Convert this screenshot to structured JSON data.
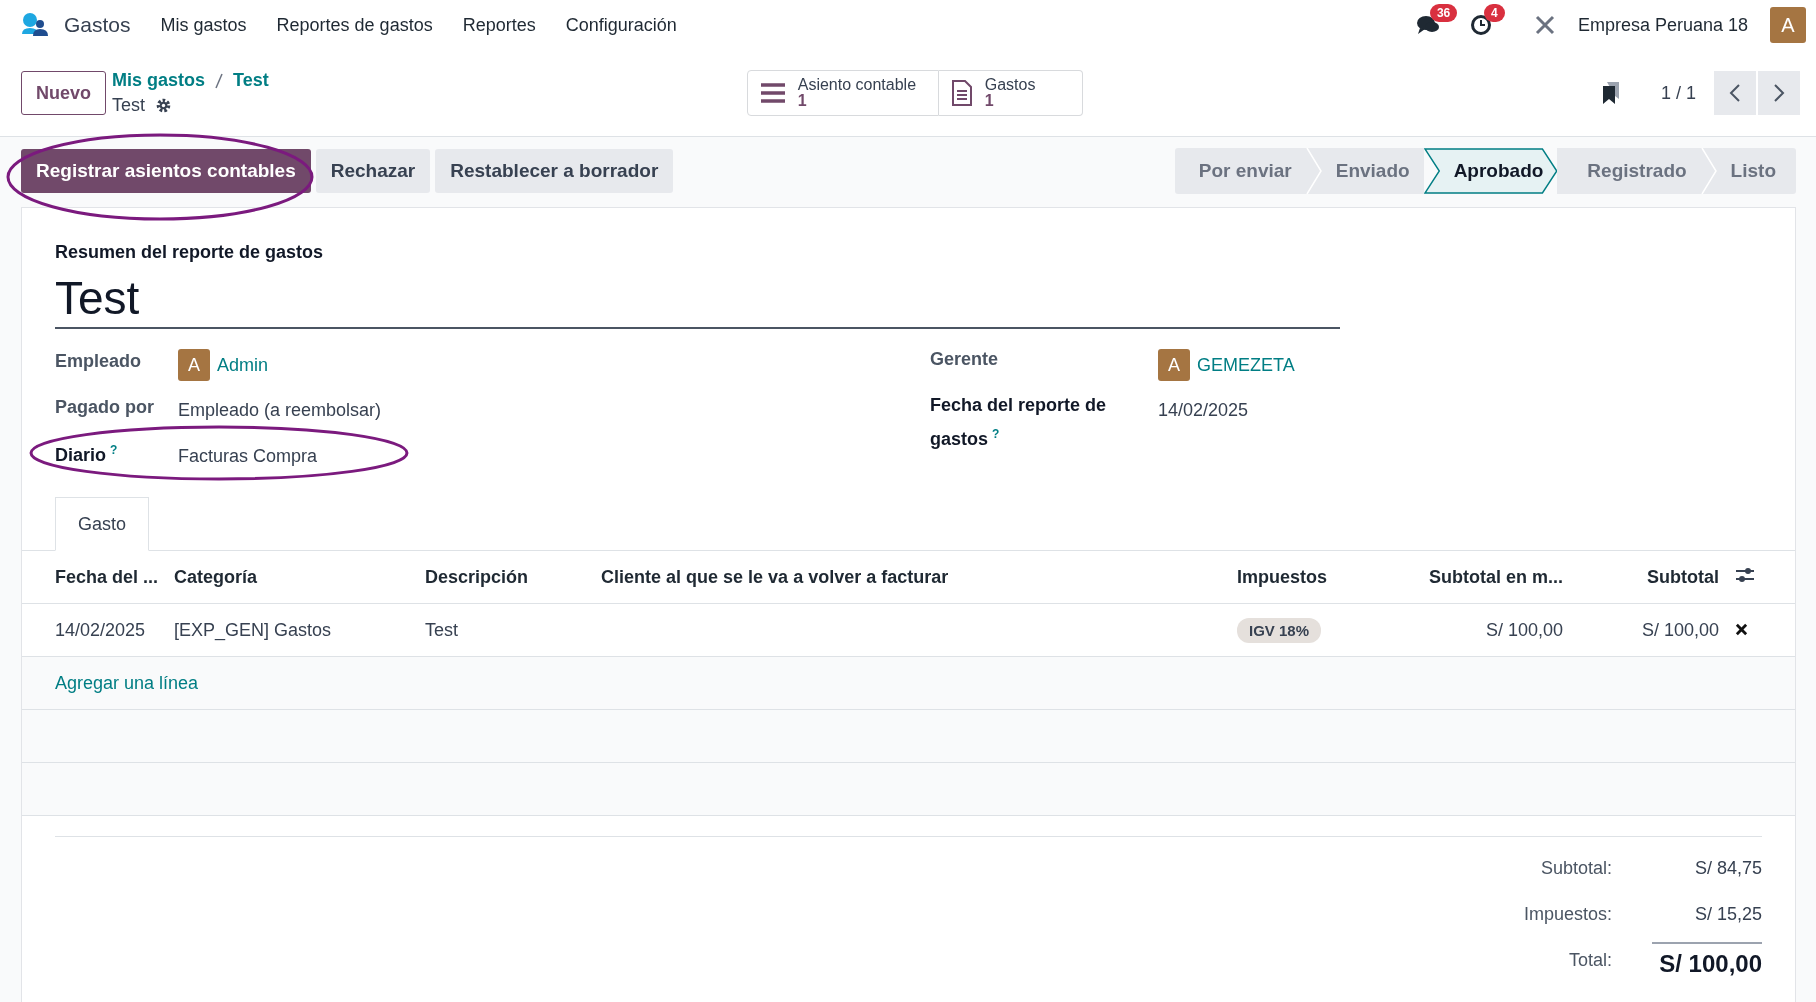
{
  "navbar": {
    "app_name": "Gastos",
    "menu": [
      "Mis gastos",
      "Reportes de gastos",
      "Reportes",
      "Configuración"
    ],
    "messages_badge": "36",
    "activities_badge": "4",
    "company": "Empresa Peruana 18",
    "avatar": "A"
  },
  "control_panel": {
    "new_button": "Nuevo",
    "breadcrumb": [
      "Mis gastos",
      "Test"
    ],
    "record_name": "Test",
    "smart_buttons": [
      {
        "kind": "list",
        "label": "Asiento contable",
        "count": "1"
      },
      {
        "kind": "document",
        "label": "Gastos",
        "count": "1"
      }
    ],
    "pager": "1 / 1"
  },
  "action_buttons": [
    {
      "label": "Registrar asientos contables",
      "primary": true,
      "highlighted": true
    },
    {
      "label": "Rechazar",
      "primary": false,
      "highlighted": false
    },
    {
      "label": "Restablecer a borrador",
      "primary": false,
      "highlighted": false
    }
  ],
  "statusbar": [
    {
      "label": "Por enviar",
      "selected": false
    },
    {
      "label": "Enviado",
      "selected": false
    },
    {
      "label": "Aprobado",
      "selected": true
    },
    {
      "label": "Registrado",
      "selected": false
    },
    {
      "label": "Listo",
      "selected": false
    }
  ],
  "form": {
    "summary_label": "Resumen del reporte de gastos",
    "title": "Test",
    "left_fields": [
      {
        "label": "Empleado",
        "value": "Admin",
        "kind": "user",
        "avatar": "A",
        "required": false,
        "highlighted": false
      },
      {
        "label": "Pagado por",
        "value": "Empleado (a reembolsar)",
        "kind": "text",
        "required": false,
        "highlighted": false
      },
      {
        "label": "Diario",
        "value": "Facturas Compra",
        "kind": "text",
        "help": "?",
        "required": true,
        "highlighted": true
      }
    ],
    "right_fields": [
      {
        "label": "Gerente",
        "value": "GEMEZETA",
        "kind": "user",
        "avatar": "A",
        "required": false,
        "highlighted": false
      },
      {
        "label": "Fecha del reporte de gastos",
        "value": "14/02/2025",
        "kind": "text",
        "help": "?",
        "required": true,
        "highlighted": false
      }
    ],
    "tabs": [
      {
        "label": "Gasto",
        "selected": true
      }
    ],
    "table": {
      "columns": [
        "Fecha del ...",
        "Categoría",
        "Descripción",
        "Cliente al que se le va a volver a facturar",
        "Impuestos",
        "Subtotal en m...",
        "Subtotal"
      ],
      "rows": [
        {
          "date": "14/02/2025",
          "category": "[EXP_GEN] Gastos",
          "description": "Test",
          "tax": "IGV 18%",
          "subtotal_company": "S/ 100,00",
          "subtotal": "S/ 100,00"
        }
      ],
      "add_line": "Agregar una línea"
    },
    "totals": [
      {
        "label": "Subtotal:",
        "value": "S/ 84,75",
        "grand": false
      },
      {
        "label": "Impuestos:",
        "value": "S/ 15,25",
        "grand": false
      },
      {
        "label": "Total:",
        "value": "S/ 100,00",
        "grand": true
      }
    ]
  }
}
